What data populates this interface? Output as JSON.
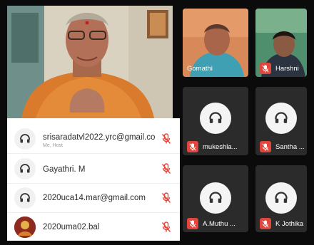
{
  "participants": [
    {
      "name": "srisaradatvl2022.yrc@gmail.co",
      "sub": "Me, Host",
      "icon": "headphones-icon"
    },
    {
      "name": "Gayathri. M",
      "sub": "",
      "icon": "headphones-icon"
    },
    {
      "name": "2020uca14.mar@gmail.com",
      "sub": "",
      "icon": "headphones-icon"
    },
    {
      "name": "2020uma02.bal",
      "sub": "",
      "icon": "profile-photo"
    }
  ],
  "tiles": [
    {
      "name": "Gomathi",
      "type": "video"
    },
    {
      "name": "Harshni",
      "type": "video"
    },
    {
      "name": "mukeshla...",
      "type": "audio"
    },
    {
      "name": "Santha ...",
      "type": "audio"
    },
    {
      "name": "A.Muthu ...",
      "type": "audio"
    },
    {
      "name": "K Jothika",
      "type": "audio"
    }
  ],
  "colors": {
    "mute_red": "#e0463c",
    "tile_bg": "#2b2b2b",
    "background": "#0b0b0b"
  }
}
